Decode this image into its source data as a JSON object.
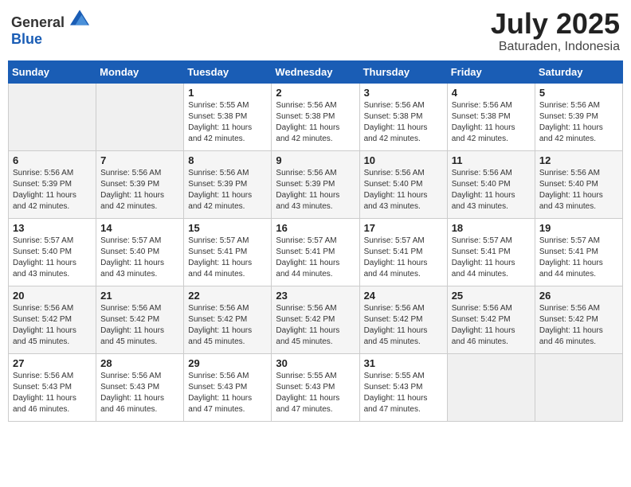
{
  "header": {
    "logo": {
      "general": "General",
      "blue": "Blue"
    },
    "title": "July 2025",
    "location": "Baturaden, Indonesia"
  },
  "weekdays": [
    "Sunday",
    "Monday",
    "Tuesday",
    "Wednesday",
    "Thursday",
    "Friday",
    "Saturday"
  ],
  "weeks": [
    [
      {
        "day": "",
        "info": ""
      },
      {
        "day": "",
        "info": ""
      },
      {
        "day": "1",
        "info": "Sunrise: 5:55 AM\nSunset: 5:38 PM\nDaylight: 11 hours and 42 minutes."
      },
      {
        "day": "2",
        "info": "Sunrise: 5:56 AM\nSunset: 5:38 PM\nDaylight: 11 hours and 42 minutes."
      },
      {
        "day": "3",
        "info": "Sunrise: 5:56 AM\nSunset: 5:38 PM\nDaylight: 11 hours and 42 minutes."
      },
      {
        "day": "4",
        "info": "Sunrise: 5:56 AM\nSunset: 5:38 PM\nDaylight: 11 hours and 42 minutes."
      },
      {
        "day": "5",
        "info": "Sunrise: 5:56 AM\nSunset: 5:39 PM\nDaylight: 11 hours and 42 minutes."
      }
    ],
    [
      {
        "day": "6",
        "info": "Sunrise: 5:56 AM\nSunset: 5:39 PM\nDaylight: 11 hours and 42 minutes."
      },
      {
        "day": "7",
        "info": "Sunrise: 5:56 AM\nSunset: 5:39 PM\nDaylight: 11 hours and 42 minutes."
      },
      {
        "day": "8",
        "info": "Sunrise: 5:56 AM\nSunset: 5:39 PM\nDaylight: 11 hours and 42 minutes."
      },
      {
        "day": "9",
        "info": "Sunrise: 5:56 AM\nSunset: 5:39 PM\nDaylight: 11 hours and 43 minutes."
      },
      {
        "day": "10",
        "info": "Sunrise: 5:56 AM\nSunset: 5:40 PM\nDaylight: 11 hours and 43 minutes."
      },
      {
        "day": "11",
        "info": "Sunrise: 5:56 AM\nSunset: 5:40 PM\nDaylight: 11 hours and 43 minutes."
      },
      {
        "day": "12",
        "info": "Sunrise: 5:56 AM\nSunset: 5:40 PM\nDaylight: 11 hours and 43 minutes."
      }
    ],
    [
      {
        "day": "13",
        "info": "Sunrise: 5:57 AM\nSunset: 5:40 PM\nDaylight: 11 hours and 43 minutes."
      },
      {
        "day": "14",
        "info": "Sunrise: 5:57 AM\nSunset: 5:40 PM\nDaylight: 11 hours and 43 minutes."
      },
      {
        "day": "15",
        "info": "Sunrise: 5:57 AM\nSunset: 5:41 PM\nDaylight: 11 hours and 44 minutes."
      },
      {
        "day": "16",
        "info": "Sunrise: 5:57 AM\nSunset: 5:41 PM\nDaylight: 11 hours and 44 minutes."
      },
      {
        "day": "17",
        "info": "Sunrise: 5:57 AM\nSunset: 5:41 PM\nDaylight: 11 hours and 44 minutes."
      },
      {
        "day": "18",
        "info": "Sunrise: 5:57 AM\nSunset: 5:41 PM\nDaylight: 11 hours and 44 minutes."
      },
      {
        "day": "19",
        "info": "Sunrise: 5:57 AM\nSunset: 5:41 PM\nDaylight: 11 hours and 44 minutes."
      }
    ],
    [
      {
        "day": "20",
        "info": "Sunrise: 5:56 AM\nSunset: 5:42 PM\nDaylight: 11 hours and 45 minutes."
      },
      {
        "day": "21",
        "info": "Sunrise: 5:56 AM\nSunset: 5:42 PM\nDaylight: 11 hours and 45 minutes."
      },
      {
        "day": "22",
        "info": "Sunrise: 5:56 AM\nSunset: 5:42 PM\nDaylight: 11 hours and 45 minutes."
      },
      {
        "day": "23",
        "info": "Sunrise: 5:56 AM\nSunset: 5:42 PM\nDaylight: 11 hours and 45 minutes."
      },
      {
        "day": "24",
        "info": "Sunrise: 5:56 AM\nSunset: 5:42 PM\nDaylight: 11 hours and 45 minutes."
      },
      {
        "day": "25",
        "info": "Sunrise: 5:56 AM\nSunset: 5:42 PM\nDaylight: 11 hours and 46 minutes."
      },
      {
        "day": "26",
        "info": "Sunrise: 5:56 AM\nSunset: 5:42 PM\nDaylight: 11 hours and 46 minutes."
      }
    ],
    [
      {
        "day": "27",
        "info": "Sunrise: 5:56 AM\nSunset: 5:43 PM\nDaylight: 11 hours and 46 minutes."
      },
      {
        "day": "28",
        "info": "Sunrise: 5:56 AM\nSunset: 5:43 PM\nDaylight: 11 hours and 46 minutes."
      },
      {
        "day": "29",
        "info": "Sunrise: 5:56 AM\nSunset: 5:43 PM\nDaylight: 11 hours and 47 minutes."
      },
      {
        "day": "30",
        "info": "Sunrise: 5:55 AM\nSunset: 5:43 PM\nDaylight: 11 hours and 47 minutes."
      },
      {
        "day": "31",
        "info": "Sunrise: 5:55 AM\nSunset: 5:43 PM\nDaylight: 11 hours and 47 minutes."
      },
      {
        "day": "",
        "info": ""
      },
      {
        "day": "",
        "info": ""
      }
    ]
  ]
}
